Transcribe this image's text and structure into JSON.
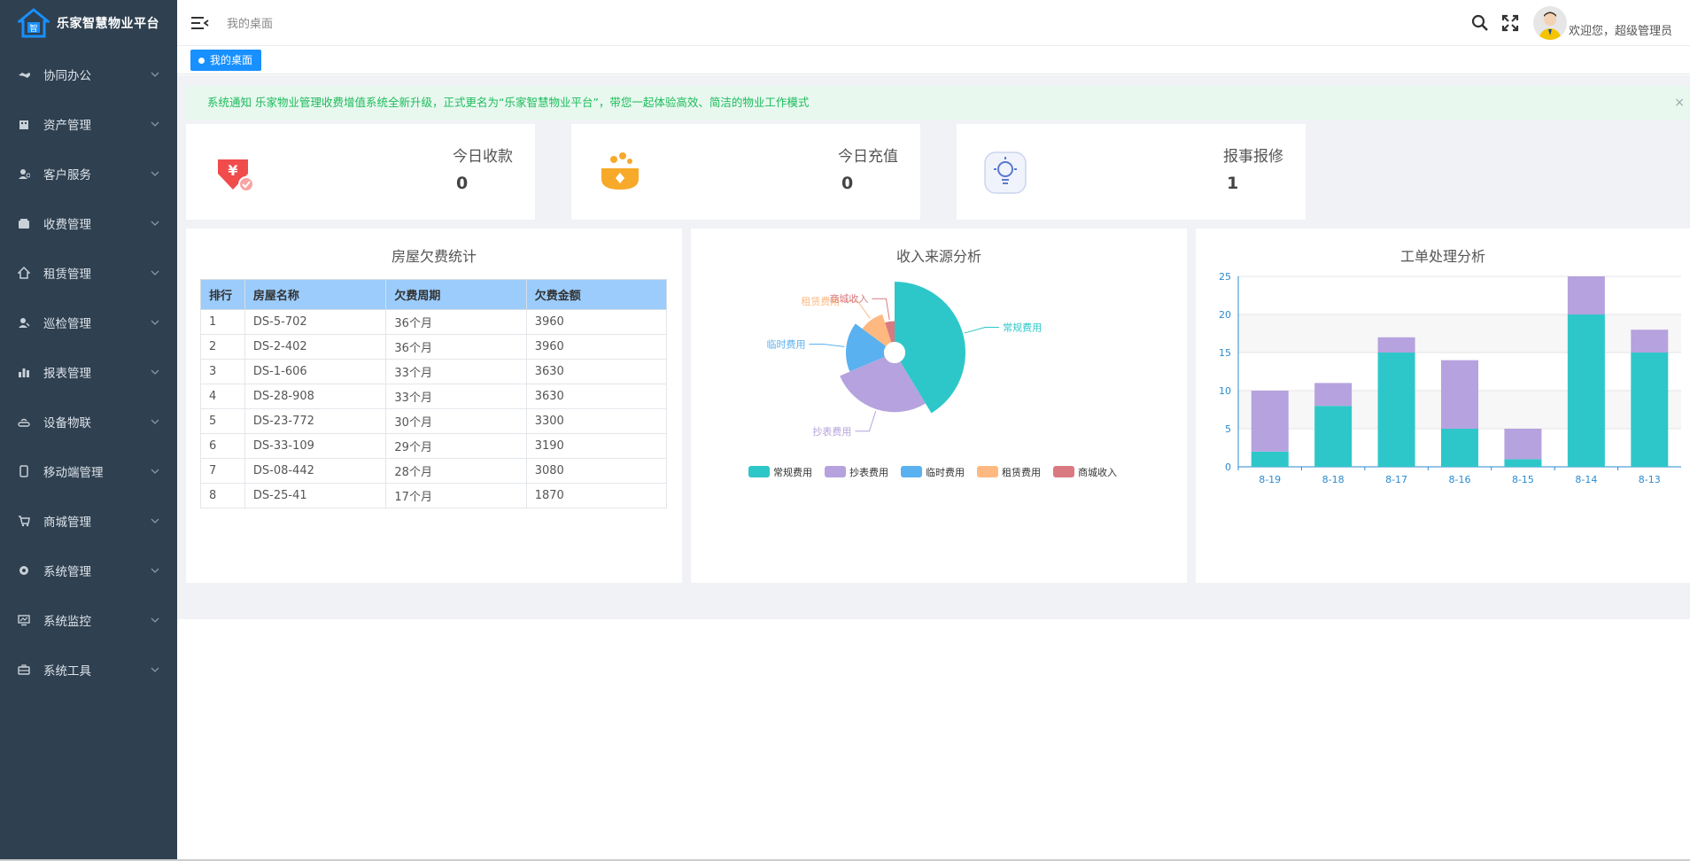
{
  "app": {
    "title": "乐家智慧物业平台"
  },
  "sidebar": {
    "items": [
      {
        "label": "协同办公",
        "icon": "handshake-icon"
      },
      {
        "label": "资产管理",
        "icon": "building-icon"
      },
      {
        "label": "客户服务",
        "icon": "user-service-icon"
      },
      {
        "label": "收费管理",
        "icon": "wallet-icon"
      },
      {
        "label": "租赁管理",
        "icon": "home-icon"
      },
      {
        "label": "巡检管理",
        "icon": "inspector-icon"
      },
      {
        "label": "报表管理",
        "icon": "bar-chart-icon"
      },
      {
        "label": "设备物联",
        "icon": "router-icon"
      },
      {
        "label": "移动端管理",
        "icon": "mobile-icon"
      },
      {
        "label": "商城管理",
        "icon": "cart-icon"
      },
      {
        "label": "系统管理",
        "icon": "gear-icon"
      },
      {
        "label": "系统监控",
        "icon": "monitor-icon"
      },
      {
        "label": "系统工具",
        "icon": "toolbox-icon"
      }
    ]
  },
  "topbar": {
    "breadcrumb": "我的桌面",
    "welcome": "欢迎您，超级管理员"
  },
  "tabs": {
    "active": "我的桌面"
  },
  "notice": {
    "text": "系统通知 乐家物业管理收费增值系统全新升级，正式更名为“乐家智慧物业平台”，带您一起体验高效、简洁的物业工作模式",
    "close": "×"
  },
  "cards": [
    {
      "title": "今日收款",
      "value": "0",
      "color": "#f04c4c"
    },
    {
      "title": "今日充值",
      "value": "0",
      "color": "#f7a92a"
    },
    {
      "title": "报事报修",
      "value": "1",
      "color": "#5a78d0"
    }
  ],
  "arrears": {
    "title": "房屋欠费统计",
    "columns": [
      "排行",
      "房屋名称",
      "欠费周期",
      "欠费金额"
    ],
    "rows": [
      [
        "1",
        "DS-5-702",
        "36个月",
        "3960"
      ],
      [
        "2",
        "DS-2-402",
        "36个月",
        "3960"
      ],
      [
        "3",
        "DS-1-606",
        "33个月",
        "3630"
      ],
      [
        "4",
        "DS-28-908",
        "33个月",
        "3630"
      ],
      [
        "5",
        "DS-23-772",
        "30个月",
        "3300"
      ],
      [
        "6",
        "DS-33-109",
        "29个月",
        "3190"
      ],
      [
        "7",
        "DS-08-442",
        "28个月",
        "3080"
      ],
      [
        "8",
        "DS-25-41",
        "17个月",
        "1870"
      ]
    ]
  },
  "chart_data": [
    {
      "type": "pie",
      "title": "收入来源分析",
      "variant": "rose",
      "categories": [
        "常规费用",
        "抄表费用",
        "临时费用",
        "租赁费用",
        "商城收入"
      ],
      "values": [
        100,
        66,
        40,
        24,
        12
      ],
      "value_note": "relative magnitudes estimated from a rose chart with no printed values",
      "colors": [
        "#2ec7c9",
        "#b6a2de",
        "#5ab1ef",
        "#ffb980",
        "#d87a80"
      ],
      "legend": "bottom"
    },
    {
      "type": "bar",
      "stacked": true,
      "title": "工单处理分析",
      "categories": [
        "8-19",
        "8-18",
        "8-17",
        "8-16",
        "8-15",
        "8-14",
        "8-13"
      ],
      "series": [
        {
          "values": [
            2,
            8,
            15,
            5,
            1,
            20,
            15
          ],
          "color": "#2ec7c9"
        },
        {
          "values": [
            8,
            3,
            2,
            9,
            4,
            5,
            3
          ],
          "color": "#b6a2de"
        }
      ],
      "ylim": [
        0,
        25
      ],
      "yticks": [
        "0",
        "5",
        "10",
        "15",
        "20",
        "25"
      ],
      "grid": true
    }
  ]
}
